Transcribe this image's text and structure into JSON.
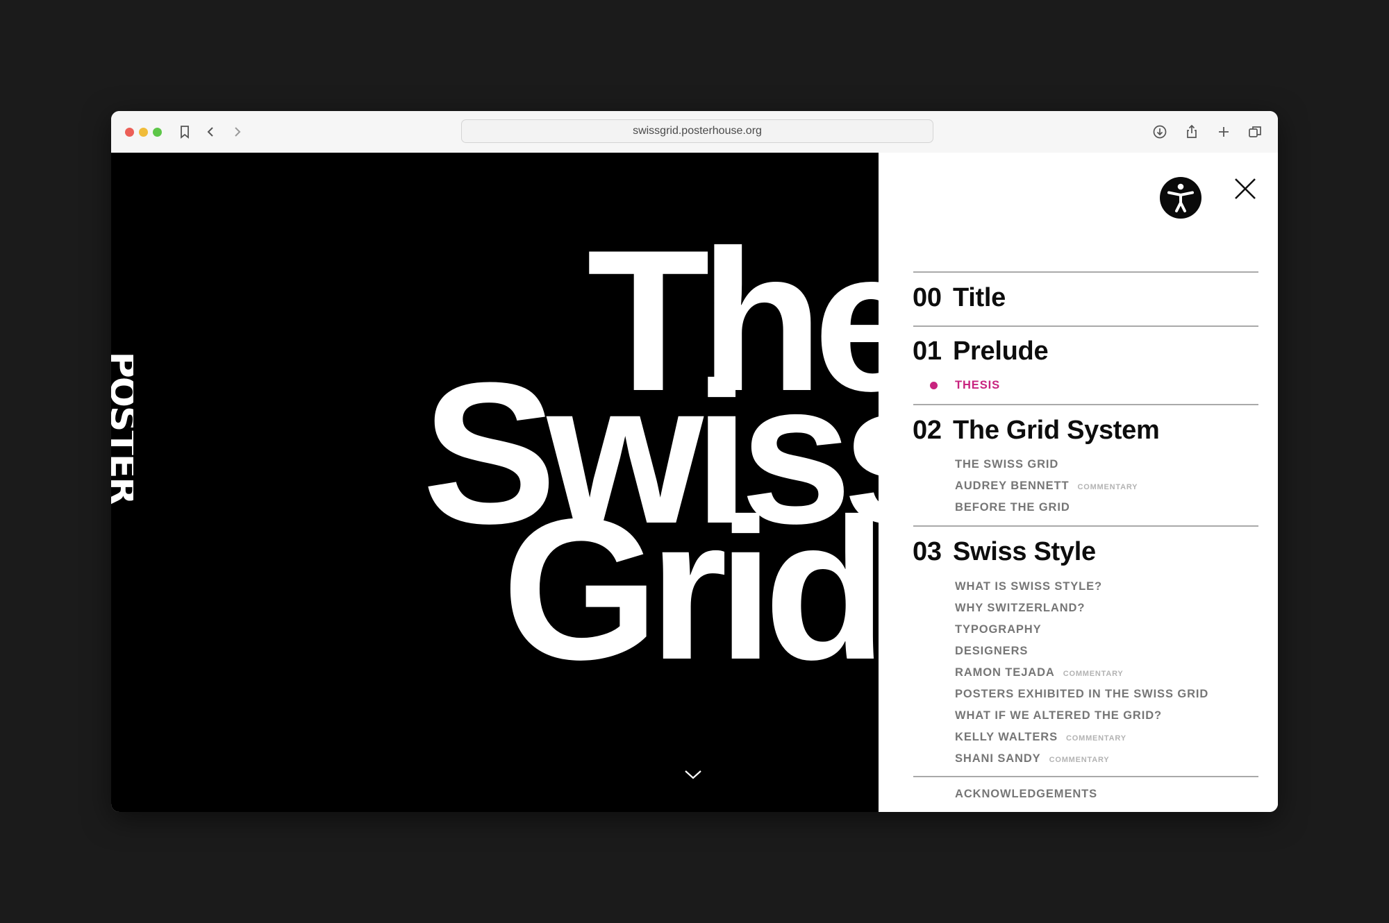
{
  "browser": {
    "url": "swissgrid.posterhouse.org",
    "traffic_lights": {
      "close": "#ec5f57",
      "minimize": "#f0bc3a",
      "zoom": "#5dc648"
    },
    "icons": [
      "sidebar-icon",
      "back-icon",
      "forward-icon",
      "download-icon",
      "share-icon",
      "new-tab-icon",
      "tabs-overview-icon"
    ]
  },
  "hero": {
    "logo": "POSTER",
    "title_lines": [
      "The",
      "Swiss",
      "Grid"
    ],
    "background": "#000000",
    "text_color": "#ffffff"
  },
  "menu": {
    "accent": "#c8237f",
    "sections": [
      {
        "number": "00",
        "title": "Title",
        "items": []
      },
      {
        "number": "01",
        "title": "Prelude",
        "items": [
          {
            "label": "THESIS",
            "tag": "",
            "active": true
          }
        ]
      },
      {
        "number": "02",
        "title": "The Grid System",
        "items": [
          {
            "label": "THE SWISS GRID",
            "tag": ""
          },
          {
            "label": "AUDREY BENNETT",
            "tag": "COMMENTARY"
          },
          {
            "label": "BEFORE THE GRID",
            "tag": ""
          }
        ]
      },
      {
        "number": "03",
        "title": "Swiss Style",
        "items": [
          {
            "label": "WHAT IS SWISS STYLE?",
            "tag": ""
          },
          {
            "label": "WHY SWITZERLAND?",
            "tag": ""
          },
          {
            "label": "TYPOGRAPHY",
            "tag": ""
          },
          {
            "label": "DESIGNERS",
            "tag": ""
          },
          {
            "label": "RAMON TEJADA",
            "tag": "COMMENTARY"
          },
          {
            "label": "POSTERS EXHIBITED IN THE SWISS GRID",
            "tag": ""
          },
          {
            "label": "WHAT IF WE ALTERED THE GRID?",
            "tag": ""
          },
          {
            "label": "KELLY WALTERS",
            "tag": "COMMENTARY"
          },
          {
            "label": "SHANI SANDY",
            "tag": "COMMENTARY"
          }
        ]
      }
    ],
    "footer_item": "ACKNOWLEDGEMENTS"
  }
}
